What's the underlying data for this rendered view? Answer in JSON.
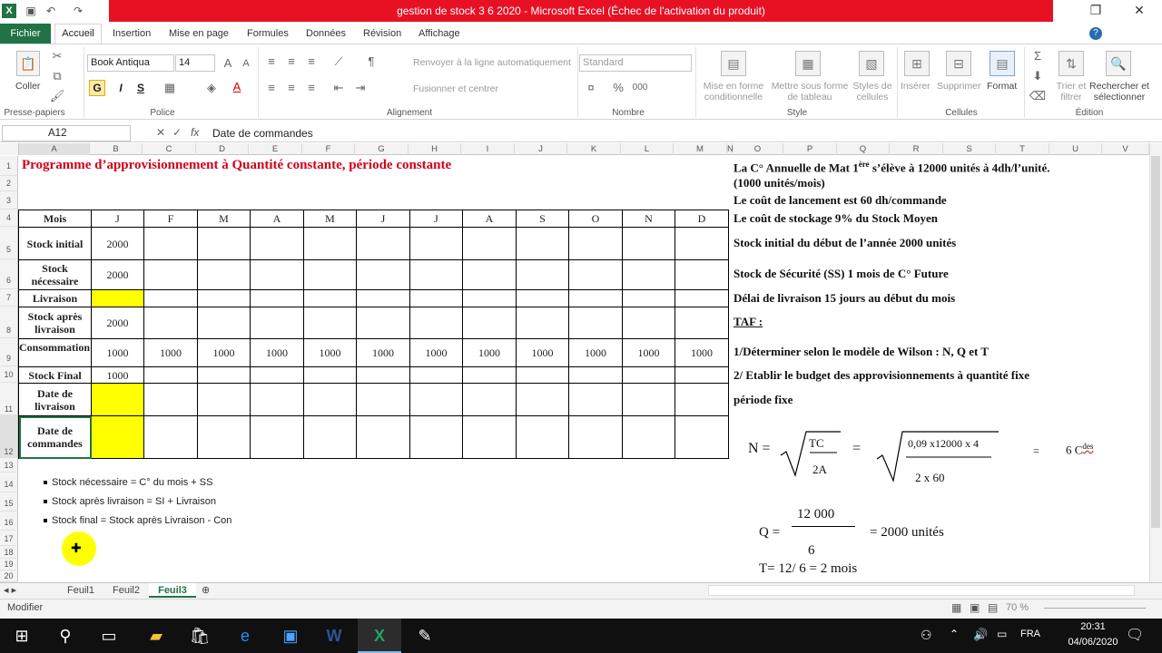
{
  "window": {
    "title": "gestion de stock 3 6 2020 - Microsoft Excel (Échec de l'activation du produit)"
  },
  "tabs": [
    "Fichier",
    "Accueil",
    "Insertion",
    "Mise en page",
    "Formules",
    "Données",
    "Révision",
    "Affichage"
  ],
  "ribbon": {
    "coller": "Coller",
    "font_name": "Book Antiqua",
    "font_size": "14",
    "bold": "G",
    "italic": "I",
    "underline": "S",
    "wrap": "Renvoyer à la ligne automatiquement",
    "merge": "Fusionner et centrer",
    "number_format": "Standard",
    "cond_format": "Mise en forme conditionnelle",
    "table_format": "Mettre sous forme de tableau",
    "cell_styles": "Styles de cellules",
    "insert": "Insérer",
    "delete": "Supprimer",
    "format": "Format",
    "sort": "Trier et filtrer",
    "find": "Rechercher et sélectionner",
    "groups": {
      "clipboard": "Presse-papiers",
      "font": "Police",
      "align": "Alignement",
      "number": "Nombre",
      "style": "Style",
      "cells": "Cellules",
      "edit": "Édition"
    }
  },
  "formula_bar": {
    "name_box": "A12",
    "fx": "fx",
    "content": "Date de commandes"
  },
  "columns": [
    "A",
    "B",
    "C",
    "D",
    "E",
    "F",
    "G",
    "H",
    "I",
    "J",
    "K",
    "L",
    "M",
    "N",
    "O",
    "P",
    "Q",
    "R",
    "S",
    "T",
    "U",
    "V"
  ],
  "rows": [
    "1",
    "2",
    "3",
    "4",
    "5",
    "6",
    "7",
    "8",
    "9",
    "10",
    "11",
    "12",
    "13",
    "14",
    "15",
    "16",
    "17",
    "18",
    "19",
    "20"
  ],
  "sheet": {
    "title": "Programme  d’approvisionnement  à Quantité constante, période constante",
    "months": [
      "Mois",
      "J",
      "F",
      "M",
      "A",
      "M",
      "J",
      "J",
      "A",
      "S",
      "O",
      "N",
      "D"
    ],
    "labels": {
      "stock_initial": "Stock initial",
      "stock_necessaire": "Stock nécessaire",
      "livraison": "Livraison",
      "stock_apres": "Stock après livraison",
      "consommation": "Consommation",
      "stock_final": "Stock Final",
      "date_livraison": "Date de livraison",
      "date_commandes": "Date de commandes"
    },
    "values": {
      "stock_initial_J": "2000",
      "stock_necessaire_J": "2000",
      "stock_apres_J": "2000",
      "consommation": "1000",
      "stock_final_J": "1000"
    },
    "notes": [
      "Stock nécessaire = C° du mois + SS",
      "Stock après livraison =    SI   +    Livraison",
      "Stock final   =  Stock après  Livraison  -   Con"
    ],
    "right_text": {
      "l1a": "La C° Annuelle de Mat 1",
      "l1sup": "ère",
      "l1b": " s’élève à 12000 unités à 4dh/l’unité.",
      "l2": "(1000 unités/mois)",
      "l3": "Le coût de lancement est 60 dh/commande",
      "l4": "Le coût de stockage 9% du Stock Moyen",
      "l5": "Stock initial du début de l’année 2000 unités",
      "l6": "Stock de Sécurité (SS) 1 mois de C° Future",
      "l7": "Délai de livraison 15 jours au début du mois",
      "l8": "TAF :",
      "l9": "1/Déterminer selon le modèle de Wilson : N, Q et T",
      "l10": "2/ Etablir le budget des approvisionnements à quantité fixe",
      "l11": "période fixe"
    },
    "formula": {
      "n": "N =",
      "tc": "TC",
      "twoa": "2A",
      "eq": "=",
      "num": "0,09 x12000 x 4",
      "den": "2 x 60",
      "eq2": "=",
      "res": "6 C",
      "res_sup": "des",
      "q": "Q =",
      "qnum": "12 000",
      "qden": "6",
      "qres": "=  2000 unités",
      "t": "T= 12/ 6 = 2 mois"
    }
  },
  "sheet_tabs": [
    "Feuil1",
    "Feuil2",
    "Feuil3"
  ],
  "status": {
    "mode": "Modifier",
    "zoom": "70 %"
  },
  "taskbar": {
    "lang": "FRA",
    "time": "20:31",
    "date": "04/06/2020"
  }
}
